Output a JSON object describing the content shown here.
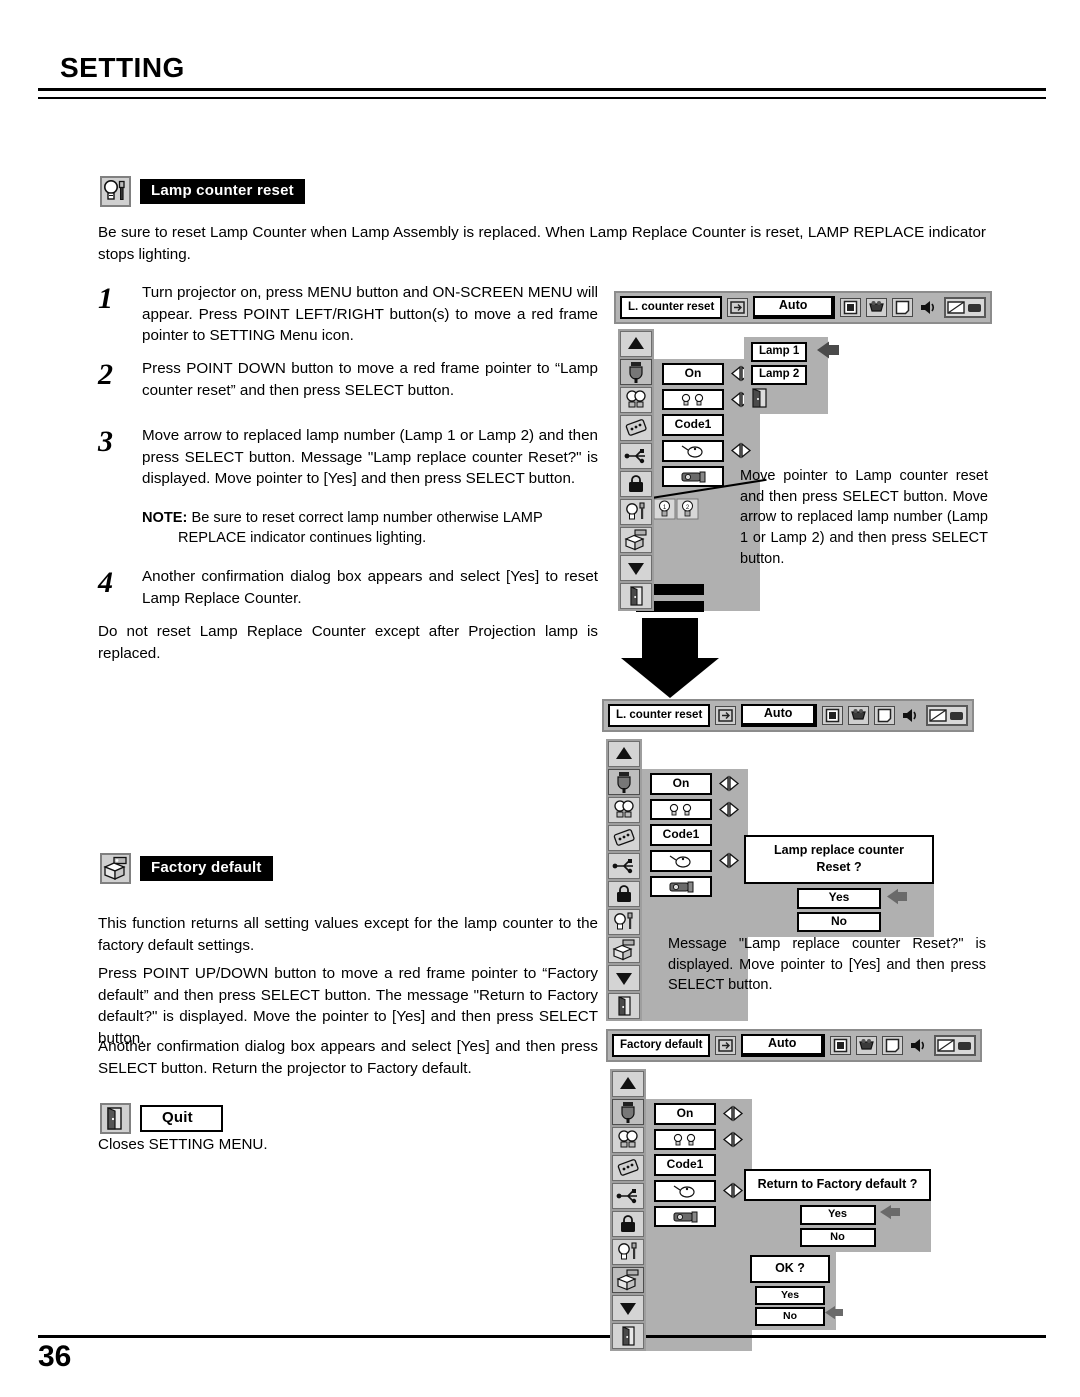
{
  "page": {
    "title": "SETTING",
    "number": "36"
  },
  "lamp_counter_section": {
    "icon": "lamp-reset-icon",
    "heading": "Lamp counter reset",
    "intro": "Be sure to reset Lamp Counter when Lamp Assembly is replaced.  When Lamp Replace Counter is reset, LAMP REPLACE indicator stops lighting.",
    "steps": [
      {
        "num": "1",
        "text": "Turn projector on, press MENU button and ON-SCREEN MENU will appear.  Press POINT LEFT/RIGHT button(s) to move a red frame pointer to SETTING Menu icon."
      },
      {
        "num": "2",
        "text": "Press POINT DOWN button to move a red frame pointer to “Lamp counter reset” and then press SELECT button."
      },
      {
        "num": "3",
        "text": "Move arrow to replaced lamp number (Lamp 1 or Lamp 2) and then press SELECT button.  Message \"Lamp replace counter Reset?\" is displayed. Move pointer to [Yes] and then press SELECT button.",
        "note_label": "NOTE:",
        "note_text": "Be sure to reset correct lamp number otherwise LAMP REPLACE indicator continues lighting."
      },
      {
        "num": "4",
        "text": "Another confirmation dialog box appears and select [Yes] to reset Lamp Replace Counter."
      }
    ],
    "closing": "Do not reset Lamp Replace Counter except after Projection lamp is replaced."
  },
  "factory_default_section": {
    "icon": "factory-default-icon",
    "heading": "Factory default",
    "paragraphs": [
      "This function returns all setting values except for the lamp counter to the factory default settings.",
      "Press POINT UP/DOWN button to move a red frame pointer to “Factory default” and then press SELECT button.  The message \"Return to Factory default?\" is displayed.  Move the pointer to [Yes] and then press SELECT button.",
      "Another confirmation dialog box appears and select [Yes] and then press SELECT button. Return the projector to Factory default."
    ]
  },
  "quit_section": {
    "icon": "quit-door-icon",
    "heading": "Quit",
    "text": "Closes SETTING MENU."
  },
  "osd_common": {
    "menu_bar_auto": "Auto",
    "bar_icons": [
      "input-icon",
      "auto-pc-icon",
      "image-select-icon",
      "image-adjust-icon",
      "screen-icon",
      "sound-icon",
      "setting-icon"
    ],
    "icon_column": [
      "scroll-up-arrow-icon",
      "power-management-icon",
      "lamp-mode-icon",
      "remote-control-code-icon",
      "usb-icon",
      "key-lock-icon",
      "lamp-counter-reset-icon",
      "factory-default-icon",
      "scroll-down-arrow-icon",
      "quit-icon"
    ],
    "values": {
      "power_management": "On",
      "lamp_mode": "lamp-pair-icon",
      "remote_code": "Code1",
      "usb": "mouse-icon",
      "key_lock": "projector-icon"
    }
  },
  "osd_diagram_1": {
    "title": "L. counter reset",
    "lamp_submenu": {
      "items": [
        "Lamp 1",
        "Lamp 2"
      ],
      "quit_icon": "quit-icon",
      "pointer": "left-arrow-pointer"
    },
    "lamp_counter_values": [
      "1",
      "2"
    ],
    "callout": "Move pointer to Lamp counter reset and then press SELECT button. Move arrow to replaced lamp number (Lamp 1 or Lamp 2) and then press SELECT button."
  },
  "osd_diagram_2": {
    "title": "L. counter reset",
    "dialog": {
      "line1": "Lamp replace counter",
      "line2": "Reset ?",
      "yes": "Yes",
      "no": "No",
      "pointer_on": "Yes"
    },
    "callout": "Message \"Lamp replace counter Reset?\" is displayed. Move pointer to [Yes] and then press SELECT button."
  },
  "osd_diagram_3": {
    "title": "Factory default",
    "dialog1": {
      "message": "Return to Factory default ?",
      "yes": "Yes",
      "no": "No",
      "pointer_on": "Yes"
    },
    "dialog2": {
      "message": "OK ?",
      "yes": "Yes",
      "no": "No",
      "pointer_on": "No"
    }
  }
}
